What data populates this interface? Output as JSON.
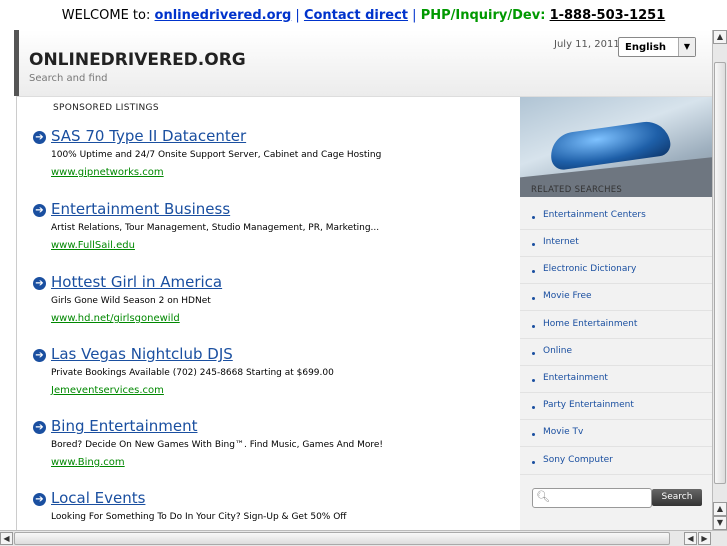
{
  "topbar": {
    "welcome": "WELCOME to:",
    "domain_link": "onlinedrivered.org",
    "sep1": "|",
    "contact_link": "Contact direct",
    "sep2": "|",
    "php_label": "PHP/Inquiry/Dev:",
    "phone": "1-888-503-1251"
  },
  "header": {
    "title": "ONLINEDRIVERED.ORG",
    "subtitle": "Search and find",
    "date": "July 11, 2011",
    "language": "English"
  },
  "main": {
    "sponsored_label": "SPONSORED LISTINGS",
    "listings": [
      {
        "title": "SAS 70 Type II Datacenter",
        "desc": "100% Uptime and 24/7 Onsite Support Server, Cabinet and Cage Hosting",
        "url": "www.gipnetworks.com"
      },
      {
        "title": "Entertainment Business",
        "desc": "Artist Relations, Tour Management, Studio Management, PR, Marketing...",
        "url": "www.FullSail.edu"
      },
      {
        "title": "Hottest Girl in America",
        "desc": "Girls Gone Wild Season 2 on HDNet",
        "url": "www.hd.net/girlsgonewild"
      },
      {
        "title": "Las Vegas Nightclub DJS",
        "desc": "Private Bookings Available (702) 245-8668 Starting at $699.00",
        "url": "Jemeventservices.com"
      },
      {
        "title": "Bing Entertainment",
        "desc": "Bored? Decide On New Games With Bing™. Find Music, Games And More!",
        "url": "www.Bing.com"
      },
      {
        "title": "Local Events",
        "desc": "Looking For Something To Do In Your City? Sign-Up & Get 50% Off",
        "url": ""
      }
    ]
  },
  "sidebar": {
    "related_title": "RELATED SEARCHES",
    "items": [
      "Entertainment Centers",
      "Internet",
      "Electronic Dictionary",
      "Movie Free",
      "Home Entertainment",
      "Online",
      "Entertainment",
      "Party Entertainment",
      "Movie Tv",
      "Sony Computer"
    ],
    "search_button": "Search",
    "search_value": ""
  },
  "icons": {
    "listing_arrow": "arrow-circle-icon",
    "search": "magnifier-icon",
    "dropdown": "triangle-down-icon"
  },
  "colors": {
    "link_blue": "#1a4fa0",
    "url_green": "#008800",
    "phone_green": "#009900"
  }
}
